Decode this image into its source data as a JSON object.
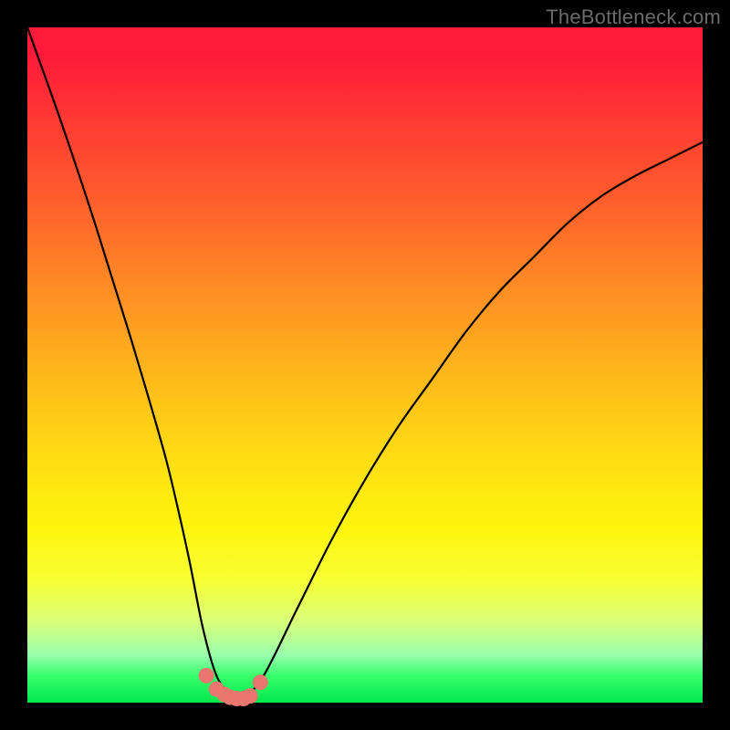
{
  "watermark": "TheBottleneck.com",
  "colors": {
    "frame_bg": "#000000",
    "gradient_top": "#ff1a3a",
    "gradient_bottom": "#00e84d",
    "curve_stroke": "#000000",
    "marker_fill": "#e9766f",
    "marker_stroke": "#e9766f"
  },
  "chart_data": {
    "type": "line",
    "title": "",
    "xlabel": "",
    "ylabel": "",
    "xlim": [
      0,
      100
    ],
    "ylim": [
      0,
      100
    ],
    "grid": false,
    "legend": false,
    "series": [
      {
        "name": "bottleneck-curve",
        "x": [
          0,
          5,
          10,
          15,
          20,
          22,
          24,
          26,
          28,
          30,
          31,
          32,
          35,
          40,
          45,
          50,
          55,
          60,
          65,
          70,
          75,
          80,
          85,
          90,
          95,
          100
        ],
        "values": [
          100,
          86,
          71,
          55,
          38,
          30,
          21,
          11,
          4,
          1.2,
          0.6,
          0.6,
          4,
          14,
          24,
          33,
          41,
          48,
          55,
          61,
          66,
          71,
          75,
          78,
          80.5,
          83
        ]
      }
    ],
    "markers": {
      "name": "trough-markers",
      "x": [
        26.5,
        28.0,
        29.2,
        30.0,
        31.0,
        32.0,
        33.0,
        34.5
      ],
      "values": [
        4.0,
        2.0,
        1.2,
        0.8,
        0.6,
        0.6,
        1.0,
        3.0
      ]
    }
  }
}
